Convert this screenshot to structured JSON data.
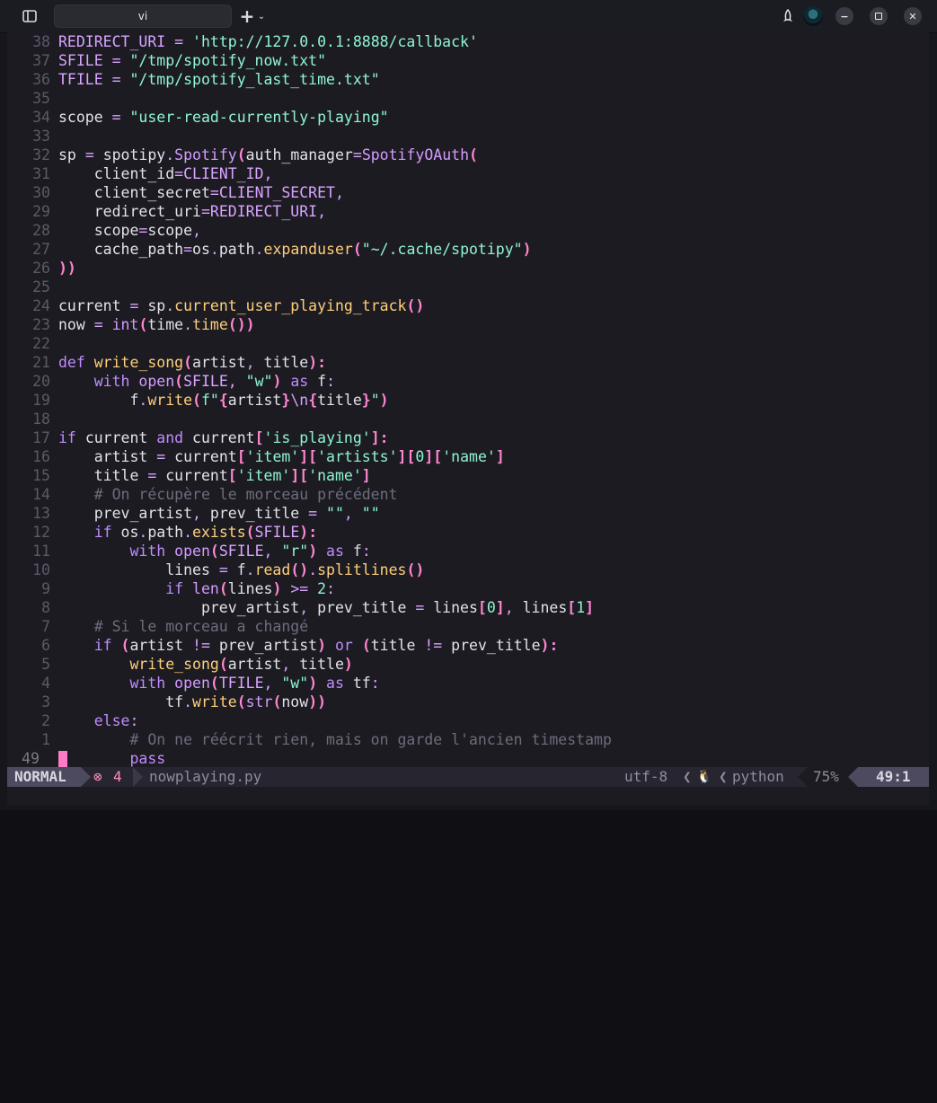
{
  "window": {
    "tab_title": "vi",
    "new_tab_symbol": "+",
    "tab_menu_symbol": "⌄",
    "minimize_symbol": "−",
    "close_symbol": "✕"
  },
  "editor": {
    "lines": [
      {
        "ln": "38",
        "tokens": [
          [
            "REDIRECT_URI ",
            "n"
          ],
          [
            "= ",
            "op"
          ],
          [
            "'http://127.0.0.1:8888/callback'",
            "s"
          ]
        ]
      },
      {
        "ln": "37",
        "tokens": [
          [
            "SFILE ",
            "n"
          ],
          [
            "= ",
            "op"
          ],
          [
            "\"/tmp/spotify_now.txt\"",
            "s"
          ]
        ]
      },
      {
        "ln": "36",
        "tokens": [
          [
            "TFILE ",
            "n"
          ],
          [
            "= ",
            "op"
          ],
          [
            "\"/tmp/spotify_last_time.txt\"",
            "s"
          ]
        ]
      },
      {
        "ln": "35",
        "tokens": []
      },
      {
        "ln": "34",
        "tokens": [
          [
            "scope ",
            ""
          ],
          [
            "= ",
            "op"
          ],
          [
            "\"user-read-currently-playing\"",
            "s"
          ]
        ]
      },
      {
        "ln": "33",
        "tokens": []
      },
      {
        "ln": "32",
        "tokens": [
          [
            "sp ",
            ""
          ],
          [
            "= ",
            "op"
          ],
          [
            "spotipy",
            ""
          ],
          [
            ".",
            "op"
          ],
          [
            "Spotify",
            "p"
          ],
          [
            "(",
            "b"
          ],
          [
            "auth_manager",
            ""
          ],
          [
            "=",
            "op"
          ],
          [
            "SpotifyOAuth",
            "p"
          ],
          [
            "(",
            "b"
          ]
        ]
      },
      {
        "ln": "31",
        "tokens": [
          [
            "    client_id",
            ""
          ],
          [
            "=",
            "op"
          ],
          [
            "CLIENT_ID",
            "n"
          ],
          [
            ",",
            "op"
          ]
        ]
      },
      {
        "ln": "30",
        "tokens": [
          [
            "    client_secret",
            ""
          ],
          [
            "=",
            "op"
          ],
          [
            "CLIENT_SECRET",
            "n"
          ],
          [
            ",",
            "op"
          ]
        ]
      },
      {
        "ln": "29",
        "tokens": [
          [
            "    redirect_uri",
            ""
          ],
          [
            "=",
            "op"
          ],
          [
            "REDIRECT_URI",
            "n"
          ],
          [
            ",",
            "op"
          ]
        ]
      },
      {
        "ln": "28",
        "tokens": [
          [
            "    scope",
            ""
          ],
          [
            "=",
            "op"
          ],
          [
            "scope",
            ""
          ],
          [
            ",",
            "op"
          ]
        ]
      },
      {
        "ln": "27",
        "tokens": [
          [
            "    cache_path",
            ""
          ],
          [
            "=",
            "op"
          ],
          [
            "os",
            ""
          ],
          [
            ".",
            "op"
          ],
          [
            "path",
            ""
          ],
          [
            ".",
            "op"
          ],
          [
            "expanduser",
            "f"
          ],
          [
            "(",
            "b"
          ],
          [
            "\"~/.cache/spotipy\"",
            "s"
          ],
          [
            ")",
            "b"
          ]
        ]
      },
      {
        "ln": "26",
        "tokens": [
          [
            "))",
            "b"
          ]
        ]
      },
      {
        "ln": "25",
        "tokens": []
      },
      {
        "ln": "24",
        "tokens": [
          [
            "current ",
            ""
          ],
          [
            "= ",
            "op"
          ],
          [
            "sp",
            ""
          ],
          [
            ".",
            "op"
          ],
          [
            "current_user_playing_track",
            "f"
          ],
          [
            "()",
            "b"
          ]
        ]
      },
      {
        "ln": "23",
        "tokens": [
          [
            "now ",
            ""
          ],
          [
            "= ",
            "op"
          ],
          [
            "int",
            "p"
          ],
          [
            "(",
            "b"
          ],
          [
            "time",
            ""
          ],
          [
            ".",
            "op"
          ],
          [
            "time",
            "f"
          ],
          [
            "())",
            "b"
          ]
        ]
      },
      {
        "ln": "22",
        "tokens": []
      },
      {
        "ln": "21",
        "tokens": [
          [
            "def ",
            "k"
          ],
          [
            "write_song",
            "f"
          ],
          [
            "(",
            "b"
          ],
          [
            "artist",
            ""
          ],
          [
            ", ",
            "op"
          ],
          [
            "title",
            ""
          ],
          [
            "):",
            "b"
          ]
        ]
      },
      {
        "ln": "20",
        "tokens": [
          [
            "    with ",
            "k"
          ],
          [
            "open",
            "p"
          ],
          [
            "(",
            "b"
          ],
          [
            "SFILE",
            "n"
          ],
          [
            ", ",
            "op"
          ],
          [
            "\"w\"",
            "s"
          ],
          [
            ")",
            "b"
          ],
          [
            " as ",
            "k"
          ],
          [
            "f",
            ""
          ],
          [
            ":",
            "op"
          ]
        ]
      },
      {
        "ln": "19",
        "tokens": [
          [
            "        f",
            ""
          ],
          [
            ".",
            "op"
          ],
          [
            "write",
            "f"
          ],
          [
            "(",
            "b"
          ],
          [
            "f\"",
            "s"
          ],
          [
            "{",
            "b"
          ],
          [
            "artist",
            ""
          ],
          [
            "}",
            "b"
          ],
          [
            "\\n",
            "op"
          ],
          [
            "{",
            "b"
          ],
          [
            "title",
            ""
          ],
          [
            "}",
            "b"
          ],
          [
            "\"",
            "s"
          ],
          [
            ")",
            "b"
          ]
        ]
      },
      {
        "ln": "18",
        "tokens": []
      },
      {
        "ln": "17",
        "tokens": [
          [
            "if ",
            "k"
          ],
          [
            "current ",
            ""
          ],
          [
            "and ",
            "k"
          ],
          [
            "current",
            ""
          ],
          [
            "[",
            "b"
          ],
          [
            "'is_playing'",
            "s"
          ],
          [
            "]:",
            "b"
          ]
        ]
      },
      {
        "ln": "16",
        "tokens": [
          [
            "    artist ",
            ""
          ],
          [
            "= ",
            "op"
          ],
          [
            "current",
            ""
          ],
          [
            "[",
            "b"
          ],
          [
            "'item'",
            "s"
          ],
          [
            "][",
            "b"
          ],
          [
            "'artists'",
            "s"
          ],
          [
            "][",
            "b"
          ],
          [
            "0",
            "s"
          ],
          [
            "][",
            "b"
          ],
          [
            "'name'",
            "s"
          ],
          [
            "]",
            "b"
          ]
        ]
      },
      {
        "ln": "15",
        "tokens": [
          [
            "    title ",
            ""
          ],
          [
            "= ",
            "op"
          ],
          [
            "current",
            ""
          ],
          [
            "[",
            "b"
          ],
          [
            "'item'",
            "s"
          ],
          [
            "][",
            "b"
          ],
          [
            "'name'",
            "s"
          ],
          [
            "]",
            "b"
          ]
        ]
      },
      {
        "ln": "14",
        "tokens": [
          [
            "    # On récupère le morceau précédent",
            "c"
          ]
        ]
      },
      {
        "ln": "13",
        "tokens": [
          [
            "    prev_artist",
            ""
          ],
          [
            ", ",
            "op"
          ],
          [
            "prev_title ",
            ""
          ],
          [
            "= ",
            "op"
          ],
          [
            "\"\"",
            "s"
          ],
          [
            ", ",
            "op"
          ],
          [
            "\"\"",
            "s"
          ]
        ]
      },
      {
        "ln": "12",
        "tokens": [
          [
            "    if ",
            "k"
          ],
          [
            "os",
            ""
          ],
          [
            ".",
            "op"
          ],
          [
            "path",
            ""
          ],
          [
            ".",
            "op"
          ],
          [
            "exists",
            "f"
          ],
          [
            "(",
            "b"
          ],
          [
            "SFILE",
            "n"
          ],
          [
            "):",
            "b"
          ]
        ]
      },
      {
        "ln": "11",
        "tokens": [
          [
            "        with ",
            "k"
          ],
          [
            "open",
            "p"
          ],
          [
            "(",
            "b"
          ],
          [
            "SFILE",
            "n"
          ],
          [
            ", ",
            "op"
          ],
          [
            "\"r\"",
            "s"
          ],
          [
            ")",
            "b"
          ],
          [
            " as ",
            "k"
          ],
          [
            "f",
            ""
          ],
          [
            ":",
            "op"
          ]
        ]
      },
      {
        "ln": "10",
        "tokens": [
          [
            "            lines ",
            ""
          ],
          [
            "= ",
            "op"
          ],
          [
            "f",
            ""
          ],
          [
            ".",
            "op"
          ],
          [
            "read",
            "f"
          ],
          [
            "()",
            "b"
          ],
          [
            ".",
            "op"
          ],
          [
            "splitlines",
            "f"
          ],
          [
            "()",
            "b"
          ]
        ]
      },
      {
        "ln": "9",
        "tokens": [
          [
            "            if ",
            "k"
          ],
          [
            "len",
            "p"
          ],
          [
            "(",
            "b"
          ],
          [
            "lines",
            ""
          ],
          [
            ") ",
            "b"
          ],
          [
            ">= ",
            "op"
          ],
          [
            "2",
            "s"
          ],
          [
            ":",
            "op"
          ]
        ]
      },
      {
        "ln": "8",
        "tokens": [
          [
            "                prev_artist",
            ""
          ],
          [
            ", ",
            "op"
          ],
          [
            "prev_title ",
            ""
          ],
          [
            "= ",
            "op"
          ],
          [
            "lines",
            ""
          ],
          [
            "[",
            "b"
          ],
          [
            "0",
            "s"
          ],
          [
            "]",
            "b"
          ],
          [
            ", ",
            "op"
          ],
          [
            "lines",
            ""
          ],
          [
            "[",
            "b"
          ],
          [
            "1",
            "s"
          ],
          [
            "]",
            "b"
          ]
        ]
      },
      {
        "ln": "7",
        "tokens": [
          [
            "    # Si le morceau a changé",
            "c"
          ]
        ]
      },
      {
        "ln": "6",
        "tokens": [
          [
            "    if ",
            "k"
          ],
          [
            "(",
            "b"
          ],
          [
            "artist ",
            ""
          ],
          [
            "!= ",
            "op"
          ],
          [
            "prev_artist",
            ""
          ],
          [
            ") ",
            "b"
          ],
          [
            "or ",
            "k"
          ],
          [
            "(",
            "b"
          ],
          [
            "title ",
            ""
          ],
          [
            "!= ",
            "op"
          ],
          [
            "prev_title",
            ""
          ],
          [
            "):",
            "b"
          ]
        ]
      },
      {
        "ln": "5",
        "tokens": [
          [
            "        write_song",
            "f"
          ],
          [
            "(",
            "b"
          ],
          [
            "artist",
            ""
          ],
          [
            ", ",
            "op"
          ],
          [
            "title",
            ""
          ],
          [
            ")",
            "b"
          ]
        ]
      },
      {
        "ln": "4",
        "tokens": [
          [
            "        with ",
            "k"
          ],
          [
            "open",
            "p"
          ],
          [
            "(",
            "b"
          ],
          [
            "TFILE",
            "n"
          ],
          [
            ", ",
            "op"
          ],
          [
            "\"w\"",
            "s"
          ],
          [
            ")",
            "b"
          ],
          [
            " as ",
            "k"
          ],
          [
            "tf",
            ""
          ],
          [
            ":",
            "op"
          ]
        ]
      },
      {
        "ln": "3",
        "tokens": [
          [
            "            tf",
            ""
          ],
          [
            ".",
            "op"
          ],
          [
            "write",
            "f"
          ],
          [
            "(",
            "b"
          ],
          [
            "str",
            "p"
          ],
          [
            "(",
            "b"
          ],
          [
            "now",
            ""
          ],
          [
            "))",
            "b"
          ]
        ]
      },
      {
        "ln": "2",
        "tokens": [
          [
            "    else",
            "k"
          ],
          [
            ":",
            "op"
          ]
        ]
      },
      {
        "ln": "1",
        "tokens": [
          [
            "        # On ne réécrit rien, mais on garde l'ancien timestamp",
            "c"
          ]
        ]
      },
      {
        "ln": "49",
        "current": true,
        "tokens": [
          [
            "        pass",
            "k"
          ]
        ]
      }
    ]
  },
  "statusline": {
    "mode": "NORMAL",
    "diagnostic_icon": "⊗",
    "diagnostic_count": "4",
    "filename": "nowplaying.py",
    "encoding": "utf-8",
    "os_icon": "🐧",
    "filetype": "python",
    "percent": "75%",
    "position": "49:1",
    "chevron": "❮"
  },
  "colors": {
    "background": "#1c1b22",
    "keyword": "#c08cff",
    "string": "#8ff5d2",
    "function": "#ffcf7a",
    "bracket": "#ff86d0",
    "comment": "#6d6c7c",
    "cursor": "#ff7ac6",
    "mode_bg": "#4d4a5f"
  }
}
